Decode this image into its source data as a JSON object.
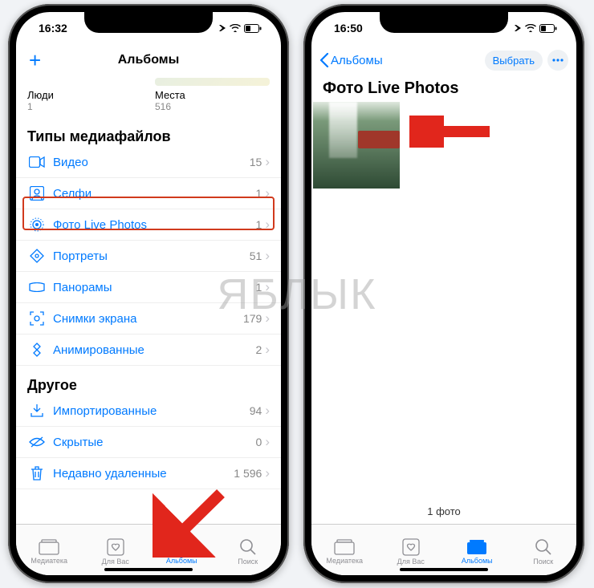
{
  "watermark": "ЯБЛЫК",
  "left": {
    "time": "16:32",
    "nav_title": "Альбомы",
    "people": {
      "label": "Люди",
      "count": "1"
    },
    "places": {
      "label": "Места",
      "count": "516"
    },
    "section_media": "Типы медиафайлов",
    "media_rows": [
      {
        "label": "Видео",
        "count": "15"
      },
      {
        "label": "Селфи",
        "count": "1"
      },
      {
        "label": "Фото Live Photos",
        "count": "1"
      },
      {
        "label": "Портреты",
        "count": "51"
      },
      {
        "label": "Панорамы",
        "count": "1"
      },
      {
        "label": "Снимки экрана",
        "count": "179"
      },
      {
        "label": "Анимированные",
        "count": "2"
      }
    ],
    "section_other": "Другое",
    "other_rows": [
      {
        "label": "Импортированные",
        "count": "94"
      },
      {
        "label": "Скрытые",
        "count": "0"
      },
      {
        "label": "Недавно удаленные",
        "count": "1 596"
      }
    ]
  },
  "right": {
    "time": "16:50",
    "back_label": "Альбомы",
    "select_label": "Выбрать",
    "title": "Фото Live Photos",
    "footer_count": "1 фото"
  },
  "tabs": {
    "library": "Медиатека",
    "for_you": "Для Вас",
    "albums": "Альбомы",
    "search": "Поиск"
  }
}
